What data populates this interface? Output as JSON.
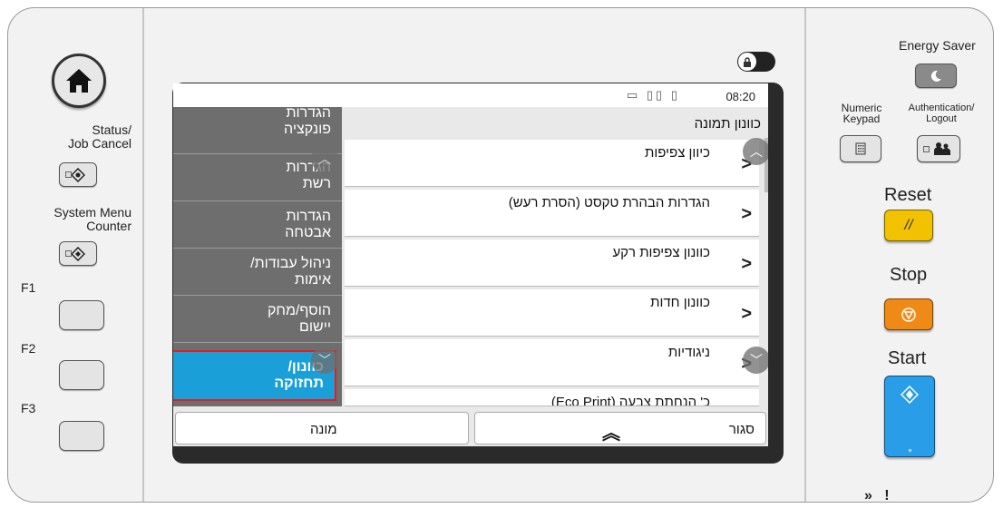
{
  "left_panel": {
    "status_label": "Status/\nJob Cancel",
    "system_menu_label": "System Menu\nCounter",
    "f1": "F1",
    "f2": "F2",
    "f3": "F3"
  },
  "right_panel": {
    "energy_saver": "Energy Saver",
    "numeric_keypad": "Numeric\nKeypad",
    "authentication": "Authentication/\nLogout",
    "reset": "Reset",
    "stop": "Stop",
    "start": "Start",
    "bottom_icons": "»   !"
  },
  "colors": {
    "reset": "#f2c200",
    "stop": "#f08a16",
    "start": "#2a9de8",
    "active_tab": "#1a9fd8",
    "highlight": "#e02020"
  },
  "status_bar": {
    "time": "08:20"
  },
  "sidebar": {
    "items": [
      {
        "label": "הגדרות\nפונקציה"
      },
      {
        "label": "הגדרות\nרשת"
      },
      {
        "label": "הגדרות\nאבטחה"
      },
      {
        "label": "ניהול עבודות/\nאימות"
      },
      {
        "label": "הוסף/מחק\nיישום"
      },
      {
        "label": "כוונון/\nתחזוקה"
      }
    ]
  },
  "main": {
    "header": "כוונון תמונה",
    "items": [
      {
        "label": "כיוון צפיפות"
      },
      {
        "label": "הגדרות הבהרת טקסט (הסרת רעש)"
      },
      {
        "label": "כוונון צפיפות רקע"
      },
      {
        "label": "כוונון חדות"
      },
      {
        "label": "ניגודיות"
      },
      {
        "label": "כ' הנחתת צבעה (Eco Print)"
      }
    ]
  },
  "bottom_bar": {
    "left_label": "מונה",
    "right_label": "סגור"
  },
  "toggle_icon": "lock-icon"
}
